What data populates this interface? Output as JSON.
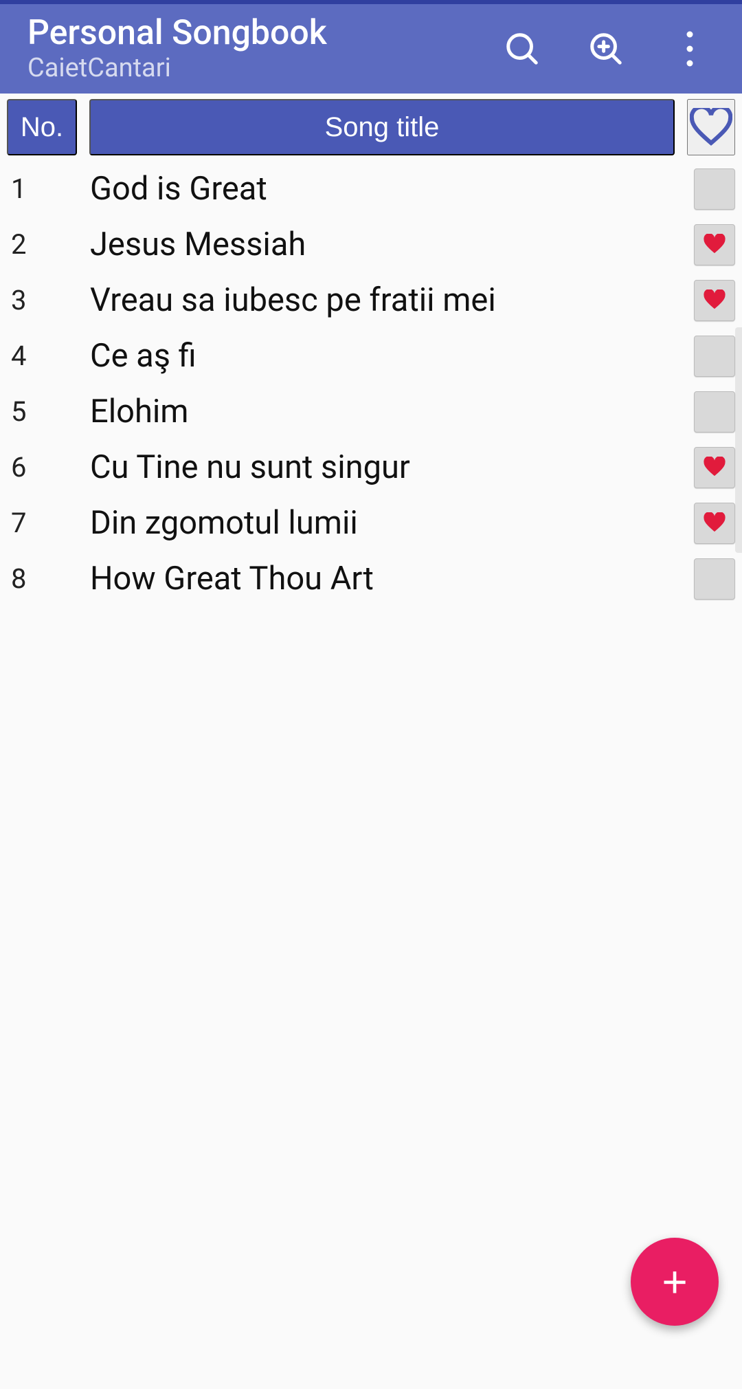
{
  "header": {
    "title": "Personal Songbook",
    "subtitle": "CaietCantari"
  },
  "columns": {
    "no": "No.",
    "title": "Song title"
  },
  "songs": [
    {
      "no": "1",
      "title": "God is Great",
      "favorite": false
    },
    {
      "no": "2",
      "title": "Jesus Messiah",
      "favorite": true
    },
    {
      "no": "3",
      "title": "Vreau sa iubesc pe fratii mei",
      "favorite": true
    },
    {
      "no": "4",
      "title": "Ce aş fi",
      "favorite": false
    },
    {
      "no": "5",
      "title": "Elohim",
      "favorite": false
    },
    {
      "no": "6",
      "title": "Cu Tine nu sunt singur",
      "favorite": true
    },
    {
      "no": "7",
      "title": "Din zgomotul lumii",
      "favorite": true
    },
    {
      "no": "8",
      "title": "How Great Thou Art",
      "favorite": false
    }
  ],
  "colors": {
    "heart_fill": "#e11b3c",
    "accent": "#5c6bc0",
    "fab": "#e91e63"
  }
}
